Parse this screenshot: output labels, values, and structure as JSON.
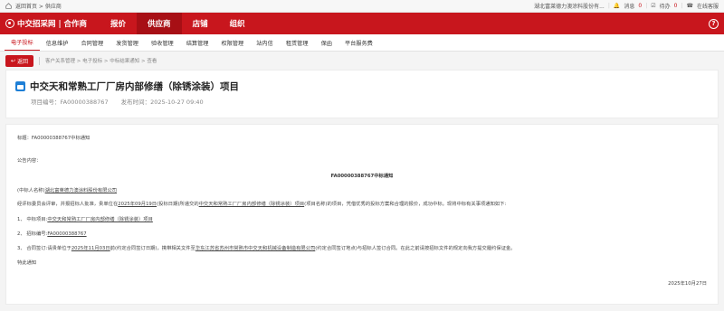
{
  "topbar": {
    "breadcrumb": "返回首页 > 供应商",
    "company": "湖北富莱德力澳涂料股份有...",
    "messages_label": "消息",
    "messages_count": "0",
    "todo_label": "待办",
    "todo_count": "0",
    "service_label": "在线客服"
  },
  "mainnav": {
    "logo": "中交招采网 | 合作商",
    "items": [
      "报价",
      "供应商",
      "店铺",
      "组织"
    ],
    "help": "?"
  },
  "subnav": {
    "items": [
      "电子投标",
      "信息维护",
      "合同管理",
      "发货管理",
      "验收管理",
      "结算管理",
      "权限管理",
      "站内信",
      "租赁管理",
      "保函",
      "平台服务费"
    ]
  },
  "crumbs": {
    "back_label": "返回",
    "path": "客户关系管理 > 电子投标 > 中标结果通知 > 查看"
  },
  "header": {
    "title": "中交天和常熟工厂厂房内部修缮（除锈涂装）项目",
    "project_no": "项目编号：FA00000388767",
    "publish_time": "发布时间：2025-10-27 09:40"
  },
  "notice": {
    "subject": "标题：FA00000388767中标通知",
    "content_label": "公告内容：",
    "heading": "FA00000388767中标通知",
    "winner_prefix": "(中标人名称)",
    "winner": "湖北富莱德力澳涂料股份有限公司",
    "intro_1": "经评标委员会评审，并报招标人批准，贵单位在",
    "intro_date": "2025年09月19日",
    "intro_2": "(投标日期)所递交的",
    "intro_project": "中交天和常熟工厂厂房内部修缮（除锈涂装）项目",
    "intro_3": "(项目名称)的项目，凭借优秀的投标方案和合理的报价，成功中标。现将中标有关事项通知如下:",
    "item1_prefix": "1、 中标项目:",
    "item1_value": "中交天和常熟工厂厂房内部修缮（除锈涂装）项目",
    "item2_prefix": "2、 招标编号:",
    "item2_value": "FA00000388767",
    "item3_1": "3、 合同签订:请贵单位于",
    "item3_date": "2025年11月03日",
    "item3_2": "前(约定合同签订日期)，携带相关文件至",
    "item3_place": "华东江苏省苏州市常熟市中交天和机械设备制造有限公司",
    "item3_3": "(约定合同签订地点)与招标人签订合同。在此之前请按招标文件的规定向我方提交履约保证金。",
    "closing": "特此通知",
    "date": "2025年10月27日"
  }
}
